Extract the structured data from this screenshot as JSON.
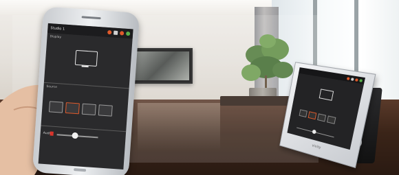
{
  "phone": {
    "title": "Studio 1",
    "display_label": "Display",
    "monitor_text": "",
    "source_label": "Source",
    "audio_label": "Audio"
  },
  "tablet": {
    "logo": "vivity"
  },
  "colors": {
    "accent_orange": "#e05a2b",
    "accent_red": "#d9342b",
    "screen_bg": "#2a2a2c",
    "floor": "#3a2418"
  },
  "icons": [
    "speaker-icon",
    "grid-icon",
    "gear-icon",
    "power-icon",
    "monitor-icon"
  ]
}
